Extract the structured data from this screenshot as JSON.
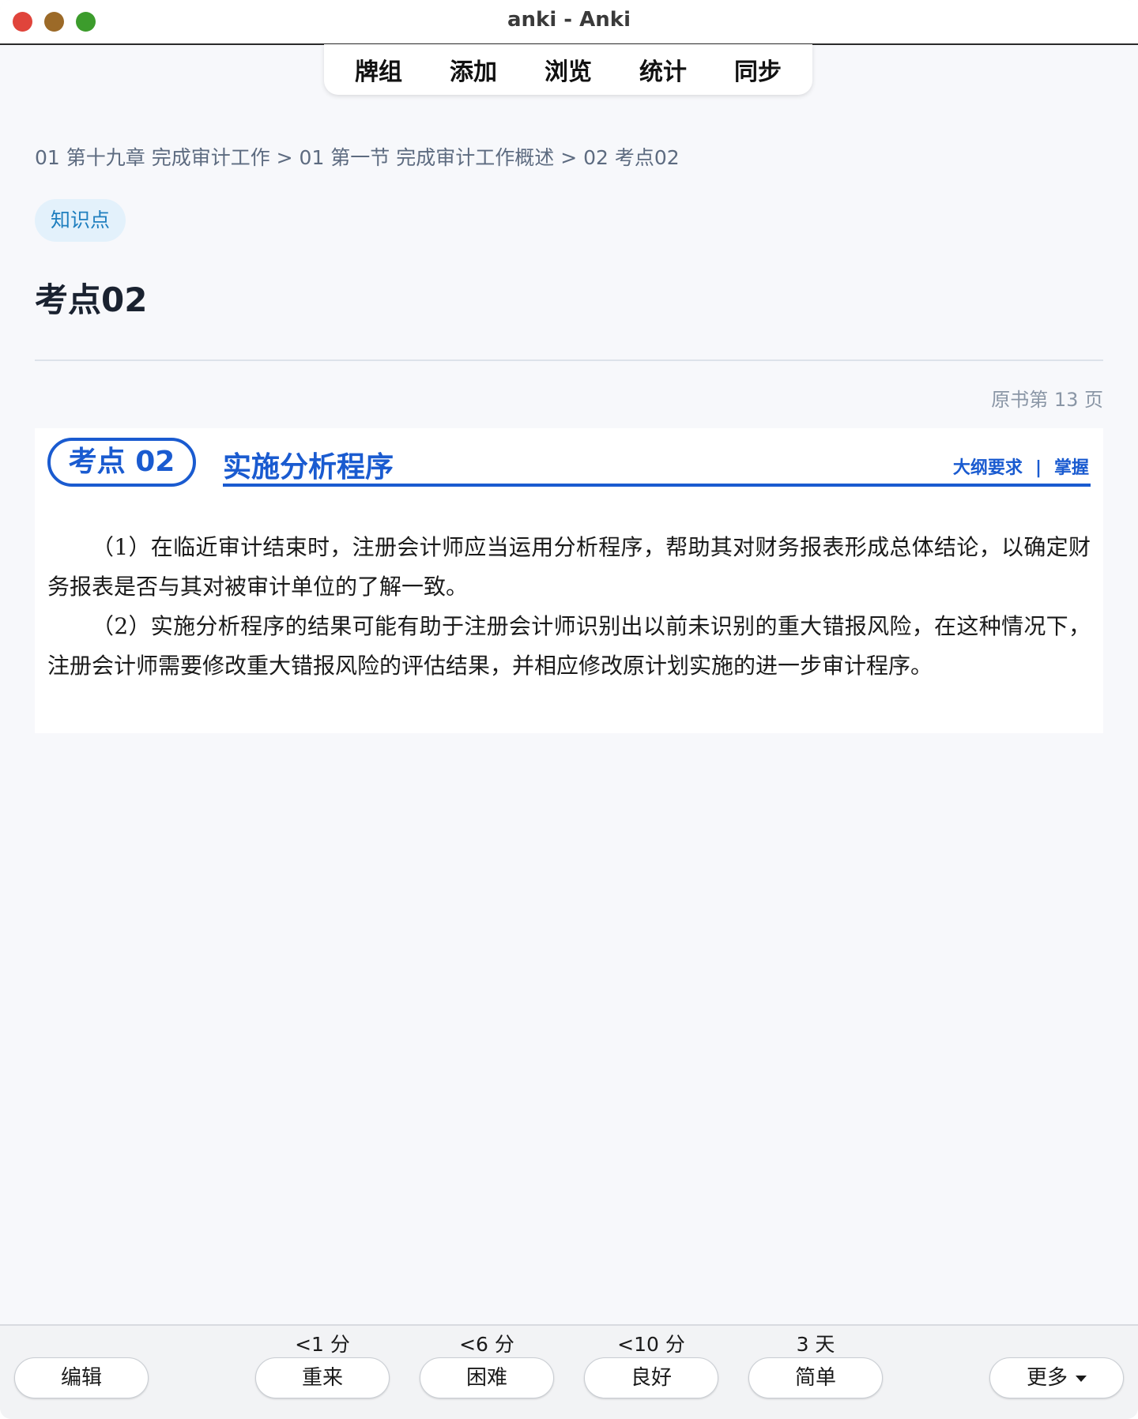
{
  "window": {
    "title": "anki - Anki"
  },
  "nav": {
    "items": [
      "牌组",
      "添加",
      "浏览",
      "统计",
      "同步"
    ]
  },
  "breadcrumb": "01 第十九章 完成审计工作 > 01 第一节 完成审计工作概述 > 02 考点02",
  "tag": "知识点",
  "heading": "考点02",
  "page_ref": "原书第 13 页",
  "book": {
    "badge": "考点 02",
    "section_title": "实施分析程序",
    "requirement_label": "大纲要求",
    "requirement_sep": "|",
    "requirement_value": "掌握",
    "paragraphs": [
      "（1）在临近审计结束时，注册会计师应当运用分析程序，帮助其对财务报表形成总体结论，以确定财务报表是否与其对被审计单位的了解一致。",
      "（2）实施分析程序的结果可能有助于注册会计师识别出以前未识别的重大错报风险，在这种情况下，注册会计师需要修改重大错报风险的评估结果，并相应修改原计划实施的进一步审计程序。"
    ]
  },
  "bottom": {
    "edit_label": "编辑",
    "more_label": "更多",
    "answers": [
      {
        "interval": "<1 分",
        "label": "重来"
      },
      {
        "interval": "<6 分",
        "label": "困难"
      },
      {
        "interval": "<10 分",
        "label": "良好"
      },
      {
        "interval": "3 天",
        "label": "简单"
      }
    ]
  }
}
